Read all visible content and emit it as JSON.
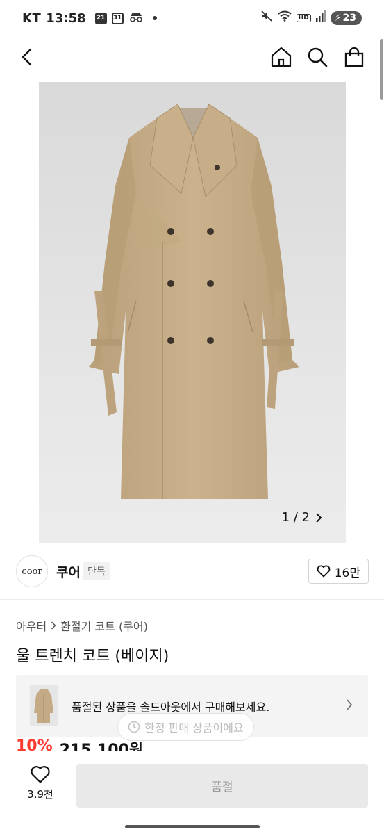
{
  "status_bar": {
    "carrier": "KT",
    "time": "13:58",
    "badge_a": "21",
    "badge_b": "31",
    "hd": "HD",
    "battery": "23"
  },
  "nav": {
    "icons": [
      "back-icon",
      "home-icon",
      "search-icon",
      "shopping-bag-icon"
    ]
  },
  "gallery": {
    "current": "1",
    "total": "2",
    "indicator": "1 / 2"
  },
  "brand": {
    "logo_text": "coor",
    "name": "쿠어",
    "badge": "단독",
    "like_count": "16만"
  },
  "breadcrumb": {
    "items": [
      "아우터",
      "환절기 코트 (쿠어)"
    ]
  },
  "product": {
    "title": "울 트렌치 코트 (베이지)",
    "discount": "10%",
    "price": "215,100원"
  },
  "soldout_banner": {
    "text": "품절된 상품을 솔드아웃에서 구매해보세요."
  },
  "toast": {
    "text": "한정 판매 상품이에요"
  },
  "bottom_bar": {
    "wish_count": "3.9천",
    "buy_label": "품절"
  },
  "colors": {
    "accent_red": "#ff3b30",
    "coat": "#c4ab85",
    "disabled_button": "#e9e9e9"
  }
}
